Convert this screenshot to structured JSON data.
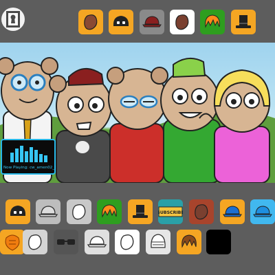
{
  "app": {
    "accent": "#f5a623",
    "home_icon": "keyhole-door-icon"
  },
  "toolbar_top": {
    "items": [
      {
        "icon": "bean-icon",
        "fill": "#8a4a33",
        "bg": "#f5a623"
      },
      {
        "icon": "mask-hair-icon",
        "fill": "#222222",
        "bg": "#f5a623"
      },
      {
        "icon": "cap-icon",
        "fill": "#8a1f1f",
        "bg": "#8a8a8a"
      },
      {
        "icon": "bean-icon",
        "fill": "#7a4030",
        "bg": "#ffffff"
      },
      {
        "icon": "hair-icon",
        "fill": "#ff8c1a",
        "bg": "#2e9e1f"
      },
      {
        "icon": "top-hat-icon",
        "fill": "#222222",
        "bg": "#f5a623"
      }
    ]
  },
  "now_playing": {
    "text": "Now Playing: cw_amen02_165",
    "accent": "#36c6f4"
  },
  "palette_row1": [
    {
      "icon": "mask-hair-icon",
      "fill": "#222222",
      "bg": "#f5a623"
    },
    {
      "icon": "cap-outline-icon",
      "fill": "#dddddd",
      "bg": "#bdbdbd"
    },
    {
      "icon": "bean-outline-icon",
      "fill": "#ffffff",
      "bg": "#c8c8c8"
    },
    {
      "icon": "hair-icon",
      "fill": "#ff8c1a",
      "bg": "#2e9e1f"
    },
    {
      "icon": "top-hat-icon",
      "fill": "#222222",
      "bg": "#f5a623"
    },
    {
      "icon": "subscribe-sign-icon",
      "label": "SUBSCRIBE",
      "fill": "#f5c542",
      "bg": "#2aa0a8"
    },
    {
      "icon": "bean-icon",
      "fill": "#7a4030",
      "bg": "#a8442c"
    },
    {
      "icon": "cap-icon",
      "fill": "#1e6fd0",
      "bg": "#f5a623"
    },
    {
      "icon": "cap-icon",
      "fill": "#1e8fe0",
      "bg": "#41b8ef"
    }
  ],
  "palette_row2": [
    {
      "icon": "orange-blob-icon",
      "fill": "#f07d0f",
      "bg": "#f5a623"
    },
    {
      "icon": "bean-outline-icon",
      "fill": "#ffffff",
      "bg": "#d4d4d4"
    },
    {
      "icon": "sunglasses-icon",
      "fill": "#222222",
      "bg": "#555555"
    },
    {
      "icon": "cap-outline-icon",
      "fill": "#ffffff",
      "bg": "#e0e0e0"
    },
    {
      "icon": "bean-outline-icon",
      "fill": "#ffffff",
      "bg": "#ffffff"
    },
    {
      "icon": "helmet-outline-icon",
      "fill": "#ffffff",
      "bg": "#e6e6e6"
    },
    {
      "icon": "hair-icon",
      "fill": "#8a4a1a",
      "bg": "#f5a623"
    },
    {
      "icon": "empty-slot-icon",
      "fill": "#000000",
      "bg": "#000000"
    }
  ]
}
